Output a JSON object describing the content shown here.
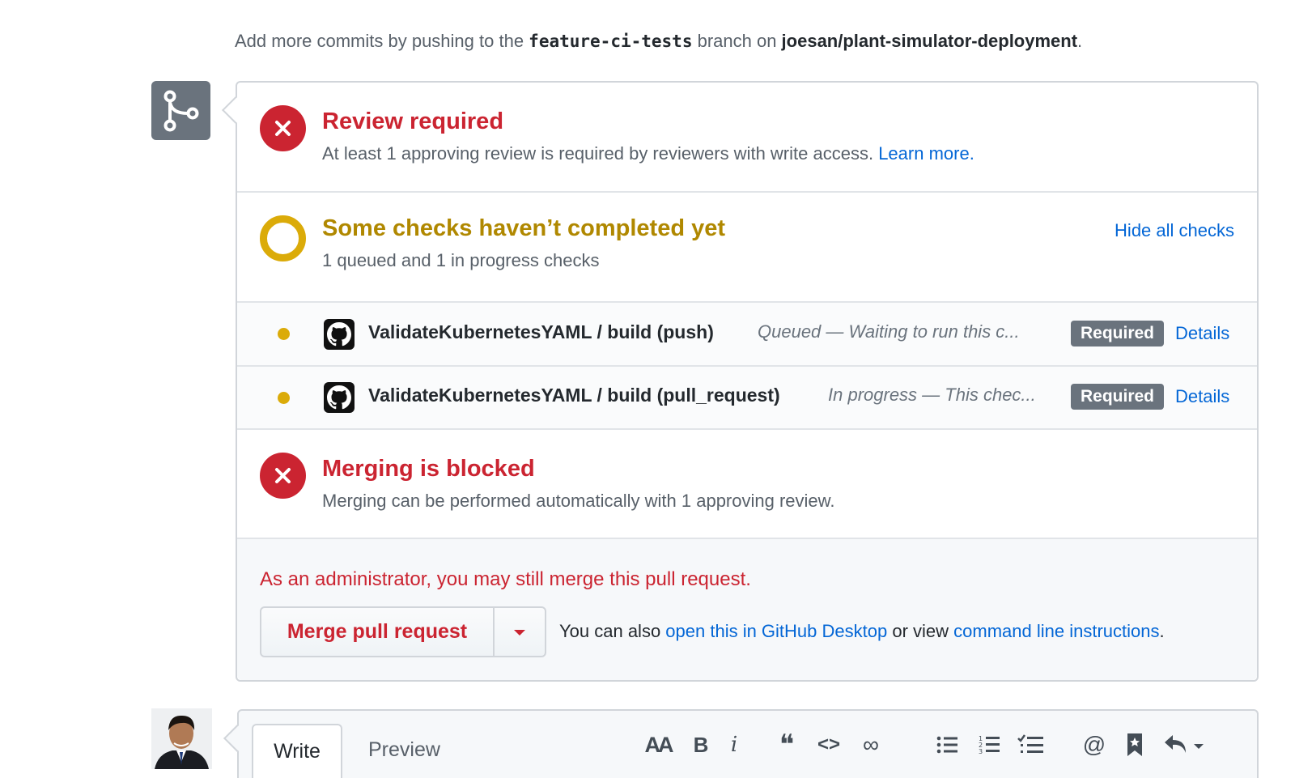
{
  "hint": {
    "prefix": "Add more commits by pushing to the ",
    "branch": "feature-ci-tests",
    "middle": " branch on ",
    "repo": "joesan/plant-simulator-deployment",
    "suffix": "."
  },
  "review": {
    "title": "Review required",
    "desc": "At least 1 approving review is required by reviewers with write access.",
    "learn_more": "Learn more."
  },
  "checks": {
    "title": "Some checks haven’t completed yet",
    "desc": "1 queued and 1 in progress checks",
    "hide_all": "Hide all checks",
    "items": [
      {
        "name": "ValidateKubernetesYAML / build (push)",
        "status": "Queued — Waiting to run this c...",
        "badge": "Required",
        "details": "Details"
      },
      {
        "name": "ValidateKubernetesYAML / build (pull_request)",
        "status": "In progress — This chec...",
        "badge": "Required",
        "details": "Details"
      }
    ]
  },
  "blocked": {
    "title": "Merging is blocked",
    "desc": "Merging can be performed automatically with 1 approving review."
  },
  "admin": {
    "message": "As an administrator, you may still merge this pull request.",
    "merge_button": "Merge pull request",
    "also_prefix": "You can also ",
    "desktop_link": "open this in GitHub Desktop",
    "also_middle": " or view ",
    "cli_link": "command line instructions",
    "also_suffix": "."
  },
  "editor": {
    "tab_write": "Write",
    "tab_preview": "Preview",
    "toolbar": {
      "heading": "AA",
      "bold": "B",
      "italic": "i",
      "quote": "❝",
      "code": "<>",
      "link": "∞",
      "mention": "@"
    }
  },
  "colors": {
    "danger": "#cb2431",
    "pending": "#dbab09",
    "link": "#0366d6",
    "badge": "#6a737d"
  },
  "icons": [
    "git-merge-icon",
    "x-icon",
    "pending-ring-icon",
    "github-icon",
    "caret-down-icon",
    "bold-icon",
    "italic-icon",
    "quote-icon",
    "code-icon",
    "link-icon",
    "unordered-list-icon",
    "ordered-list-icon",
    "task-list-icon",
    "mention-icon",
    "bookmark-icon",
    "reply-icon"
  ]
}
